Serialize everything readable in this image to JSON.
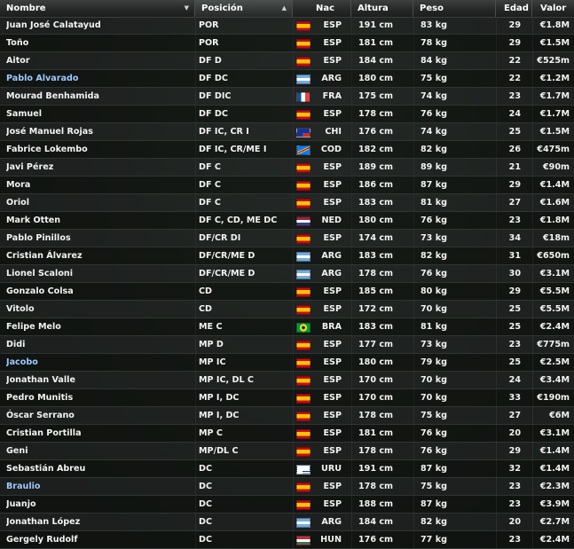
{
  "columns": {
    "nombre": "Nombre",
    "posicion": "Posición",
    "nac": "Nac",
    "altura": "Altura",
    "peso": "Peso",
    "edad": "Edad",
    "valor": "Valor"
  },
  "sort_indicators": {
    "nombre": "▼",
    "posicion": "▲"
  },
  "flag_colors": {
    "ESP": [
      "#c60b1e",
      "#ffc400",
      "#c60b1e"
    ],
    "ARG": [
      "#74acdf",
      "#ffffff",
      "#74acdf"
    ],
    "FRA": [
      "#0055a4",
      "#ffffff",
      "#ef4135"
    ],
    "CHI": [
      "#ffffff",
      "#d52b1e"
    ],
    "COD": [
      "#007fff",
      "#f7d618",
      "#ce1021"
    ],
    "NED": [
      "#ae1c28",
      "#ffffff",
      "#21468b"
    ],
    "BRA": [
      "#009c3b",
      "#ffdf00",
      "#002776"
    ],
    "URU": [
      "#ffffff",
      "#0038a8"
    ],
    "HUN": [
      "#ce2939",
      "#ffffff",
      "#477050"
    ]
  },
  "rows": [
    {
      "name": "Juan José Calatayud",
      "highlight": false,
      "pos": "POR",
      "nac": "ESP",
      "alt": "191 cm",
      "peso": "83 kg",
      "edad": "29",
      "valor": "€1.8M"
    },
    {
      "name": "Toño",
      "highlight": false,
      "pos": "POR",
      "nac": "ESP",
      "alt": "181 cm",
      "peso": "78 kg",
      "edad": "29",
      "valor": "€1.5M"
    },
    {
      "name": "Aitor",
      "highlight": false,
      "pos": "DF D",
      "nac": "ESP",
      "alt": "184 cm",
      "peso": "84 kg",
      "edad": "22",
      "valor": "€525m"
    },
    {
      "name": "Pablo Alvarado",
      "highlight": true,
      "pos": "DF DC",
      "nac": "ARG",
      "alt": "180 cm",
      "peso": "75 kg",
      "edad": "22",
      "valor": "€1.2M"
    },
    {
      "name": "Mourad Benhamida",
      "highlight": false,
      "pos": "DF DIC",
      "nac": "FRA",
      "alt": "175 cm",
      "peso": "74 kg",
      "edad": "23",
      "valor": "€1.7M"
    },
    {
      "name": "Samuel",
      "highlight": false,
      "pos": "DF DC",
      "nac": "ESP",
      "alt": "178 cm",
      "peso": "76 kg",
      "edad": "24",
      "valor": "€1.7M"
    },
    {
      "name": "José Manuel Rojas",
      "highlight": false,
      "pos": "DF IC, CR I",
      "nac": "CHI",
      "alt": "176 cm",
      "peso": "74 kg",
      "edad": "25",
      "valor": "€1.5M"
    },
    {
      "name": "Fabrice Lokembo",
      "highlight": false,
      "pos": "DF IC, CR/ME I",
      "nac": "COD",
      "alt": "182 cm",
      "peso": "82 kg",
      "edad": "26",
      "valor": "€475m"
    },
    {
      "name": "Javi Pérez",
      "highlight": false,
      "pos": "DF C",
      "nac": "ESP",
      "alt": "189 cm",
      "peso": "89 kg",
      "edad": "21",
      "valor": "€90m"
    },
    {
      "name": "Mora",
      "highlight": false,
      "pos": "DF C",
      "nac": "ESP",
      "alt": "186 cm",
      "peso": "87 kg",
      "edad": "29",
      "valor": "€1.4M"
    },
    {
      "name": "Oriol",
      "highlight": false,
      "pos": "DF C",
      "nac": "ESP",
      "alt": "183 cm",
      "peso": "81 kg",
      "edad": "27",
      "valor": "€1.6M"
    },
    {
      "name": "Mark Otten",
      "highlight": false,
      "pos": "DF C, CD, ME DC",
      "nac": "NED",
      "alt": "180 cm",
      "peso": "76 kg",
      "edad": "23",
      "valor": "€1.8M"
    },
    {
      "name": "Pablo Pinillos",
      "highlight": false,
      "pos": "DF/CR DI",
      "nac": "ESP",
      "alt": "174 cm",
      "peso": "73 kg",
      "edad": "34",
      "valor": "€18m"
    },
    {
      "name": "Cristian Álvarez",
      "highlight": false,
      "pos": "DF/CR/ME D",
      "nac": "ARG",
      "alt": "183 cm",
      "peso": "82 kg",
      "edad": "31",
      "valor": "€650m"
    },
    {
      "name": "Lionel Scaloni",
      "highlight": false,
      "pos": "DF/CR/ME D",
      "nac": "ARG",
      "alt": "178 cm",
      "peso": "76 kg",
      "edad": "30",
      "valor": "€3.1M"
    },
    {
      "name": "Gonzalo Colsa",
      "highlight": false,
      "pos": "CD",
      "nac": "ESP",
      "alt": "185 cm",
      "peso": "80 kg",
      "edad": "29",
      "valor": "€5.5M"
    },
    {
      "name": "Vitolo",
      "highlight": false,
      "pos": "CD",
      "nac": "ESP",
      "alt": "172 cm",
      "peso": "70 kg",
      "edad": "25",
      "valor": "€5.5M"
    },
    {
      "name": "Felipe Melo",
      "highlight": false,
      "pos": "ME C",
      "nac": "BRA",
      "alt": "183 cm",
      "peso": "81 kg",
      "edad": "25",
      "valor": "€2.4M"
    },
    {
      "name": "Didi",
      "highlight": false,
      "pos": "MP D",
      "nac": "ESP",
      "alt": "177 cm",
      "peso": "73 kg",
      "edad": "23",
      "valor": "€775m"
    },
    {
      "name": "Jacobo",
      "highlight": true,
      "pos": "MP IC",
      "nac": "ESP",
      "alt": "180 cm",
      "peso": "79 kg",
      "edad": "25",
      "valor": "€2.5M"
    },
    {
      "name": "Jonathan Valle",
      "highlight": false,
      "pos": "MP IC, DL C",
      "nac": "ESP",
      "alt": "170 cm",
      "peso": "70 kg",
      "edad": "24",
      "valor": "€3.4M"
    },
    {
      "name": "Pedro Munitis",
      "highlight": false,
      "pos": "MP I, DC",
      "nac": "ESP",
      "alt": "170 cm",
      "peso": "70 kg",
      "edad": "33",
      "valor": "€190m"
    },
    {
      "name": "Óscar Serrano",
      "highlight": false,
      "pos": "MP I, DC",
      "nac": "ESP",
      "alt": "178 cm",
      "peso": "75 kg",
      "edad": "27",
      "valor": "€6M"
    },
    {
      "name": "Cristian Portilla",
      "highlight": false,
      "pos": "MP C",
      "nac": "ESP",
      "alt": "181 cm",
      "peso": "76 kg",
      "edad": "20",
      "valor": "€3.1M"
    },
    {
      "name": "Geni",
      "highlight": false,
      "pos": "MP/DL C",
      "nac": "ESP",
      "alt": "178 cm",
      "peso": "76 kg",
      "edad": "29",
      "valor": "€1.4M"
    },
    {
      "name": "Sebastián Abreu",
      "highlight": false,
      "pos": "DC",
      "nac": "URU",
      "alt": "191 cm",
      "peso": "87 kg",
      "edad": "32",
      "valor": "€1.4M"
    },
    {
      "name": "Braulio",
      "highlight": true,
      "pos": "DC",
      "nac": "ESP",
      "alt": "178 cm",
      "peso": "75 kg",
      "edad": "23",
      "valor": "€2.3M"
    },
    {
      "name": "Juanjo",
      "highlight": false,
      "pos": "DC",
      "nac": "ESP",
      "alt": "188 cm",
      "peso": "87 kg",
      "edad": "23",
      "valor": "€3.9M"
    },
    {
      "name": "Jonathan López",
      "highlight": false,
      "pos": "DC",
      "nac": "ARG",
      "alt": "184 cm",
      "peso": "82 kg",
      "edad": "20",
      "valor": "€2.7M"
    },
    {
      "name": "Gergely Rudolf",
      "highlight": false,
      "pos": "DC",
      "nac": "HUN",
      "alt": "176 cm",
      "peso": "77 kg",
      "edad": "23",
      "valor": "€2.4M"
    }
  ]
}
